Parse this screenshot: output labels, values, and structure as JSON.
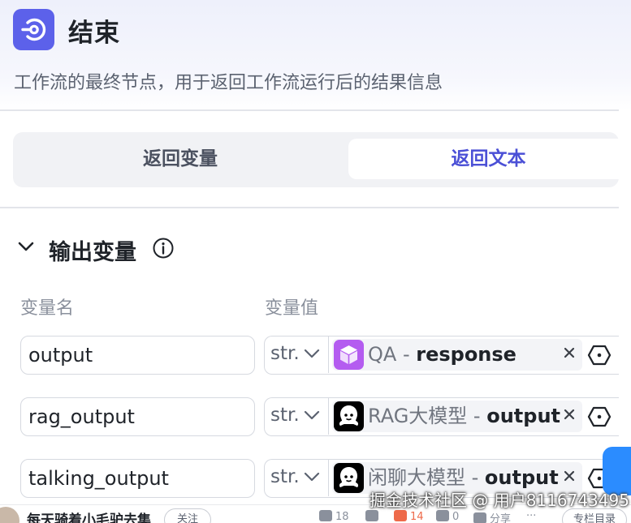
{
  "node": {
    "title": "结束",
    "description": "工作流的最终节点，用于返回工作流运行后的结果信息",
    "icon": "end-node-icon",
    "accent_color": "#5c61ea"
  },
  "tabs": [
    {
      "label": "返回变量",
      "active": false
    },
    {
      "label": "返回文本",
      "active": true
    }
  ],
  "section": {
    "title": "输出变量",
    "col_name": "变量名",
    "col_value": "变量值"
  },
  "variables": [
    {
      "name": "output",
      "type": "str.",
      "ref_node": "QA",
      "separator": " - ",
      "ref_var": "response",
      "icon": "cube-icon",
      "icon_color": "#b45cf0"
    },
    {
      "name": "rag_output",
      "type": "str.",
      "ref_node": "RAG大模型",
      "separator": " - ",
      "ref_var": "output",
      "icon": "llm-icon",
      "icon_color": "#000000"
    },
    {
      "name": "talking_output",
      "type": "str.",
      "ref_node": "闲聊大模型",
      "separator": " - ",
      "ref_var": "output",
      "icon": "llm-icon",
      "icon_color": "#000000"
    }
  ],
  "watermark": "掘金技术社区 @ 用户8116743495",
  "bottom_bar": {
    "author": "每天骑着小毛驴去集",
    "follow": "关注",
    "likes": "18",
    "stars": "14",
    "comments": "0",
    "share": "分享",
    "more": "···",
    "toc": "专栏目录"
  }
}
